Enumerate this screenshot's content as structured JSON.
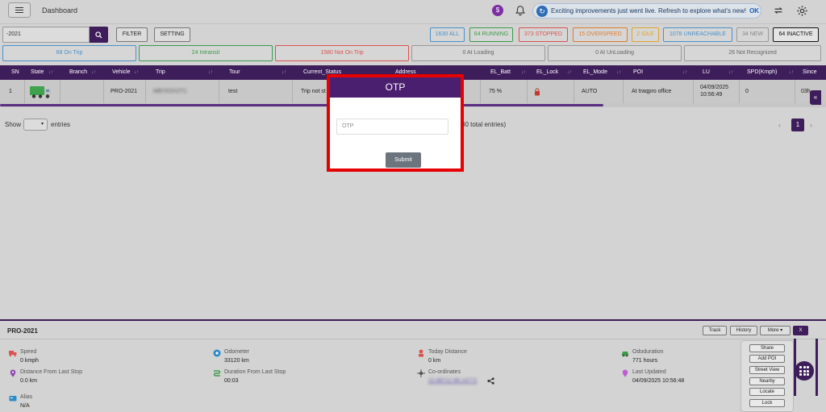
{
  "header": {
    "menu_icon": "hamburger-icon",
    "title": "Dashboard",
    "notice_text": "Exciting improvements just went live. Refresh to explore what's new!",
    "notice_ok": "OK"
  },
  "toolbar": {
    "search_value": "-2021",
    "filter_label": "FILTER",
    "setting_label": "SETTING"
  },
  "status_buttons": [
    {
      "label": "1630 ALL",
      "color": "#4a90c8"
    },
    {
      "label": "64 RUNNING",
      "color": "#3c9a4a"
    },
    {
      "label": "373 STOPPED",
      "color": "#d9534f"
    },
    {
      "label": "15 OVERSPEED",
      "color": "#e07b2a"
    },
    {
      "label": "2 IDLE",
      "color": "#e0a52a"
    },
    {
      "label": "1078 UNREACHABLE",
      "color": "#4a90c8"
    },
    {
      "label": "34 NEW",
      "color": "#999999"
    },
    {
      "label": "64 INACTIVE",
      "color": "#111111"
    }
  ],
  "trip_chips": [
    {
      "label": "68  On Trip",
      "color": "#4a90c8"
    },
    {
      "label": "24  Intransit",
      "color": "#3c9a4a"
    },
    {
      "label": "1580  Not On Trip",
      "color": "#d9534f"
    },
    {
      "label": "0  At Loading",
      "color": "#888888"
    },
    {
      "label": "0  At UnLoading",
      "color": "#888888"
    },
    {
      "label": "26  Not Recognized",
      "color": "#888888"
    }
  ],
  "table": {
    "headers": [
      "SN",
      "State",
      "Branch",
      "Vehicle",
      "Trip",
      "Tour",
      "Current_Status",
      "Address",
      "EL_Batt",
      "EL_Lock",
      "EL_Mode",
      "POI",
      "LU",
      "SPD(Kmph)",
      "Since"
    ],
    "row": {
      "sn": "1",
      "vehicle": "PRO-2021",
      "trip": "MBYKDV2T1",
      "tour": "test",
      "current_status": "Trip not st",
      "el_batt": "75 %",
      "el_mode": "AUTO",
      "poi": "At traqpro office",
      "lu_date": "04/09/2025",
      "lu_time": "10:56:49",
      "spd": "0",
      "since": "03h"
    }
  },
  "pagination": {
    "show_label": "Show",
    "entries_label": "entries",
    "total_text": "30 total entries)",
    "page": "1"
  },
  "panel": {
    "vehicle": "PRO-2021",
    "buttons": {
      "track": "Track",
      "history": "History",
      "more": "More",
      "close": "X"
    },
    "speed_label": "Speed",
    "speed_value": "0 kmph",
    "odometer_label": "Odometer",
    "odometer_value": "33120 km",
    "today_label": "Today Distance",
    "today_value": "0 km",
    "odo_label": "Ododuration",
    "odo_value": "771 hours",
    "dist_label": "Distance From Last Stop",
    "dist_value": "0.0 km",
    "dur_label": "Duration From Last Stop",
    "dur_value": "00:03",
    "coord_label": "Co-ordinates",
    "coord_value": "22.88712 88.14772",
    "updated_label": "Last Updated",
    "updated_value": "04/09/2025 10:56:48",
    "alias_label": "Alias",
    "alias_value": "N/A"
  },
  "fab_menu": [
    "Share",
    "Add POI",
    "Street View",
    "Nearby",
    "Locate",
    "Lock"
  ],
  "modal": {
    "title": "OTP",
    "placeholder": "OTP",
    "submit": "Submit"
  },
  "colors": {
    "accent": "#3d1d5a",
    "highlight": "#e60000"
  }
}
